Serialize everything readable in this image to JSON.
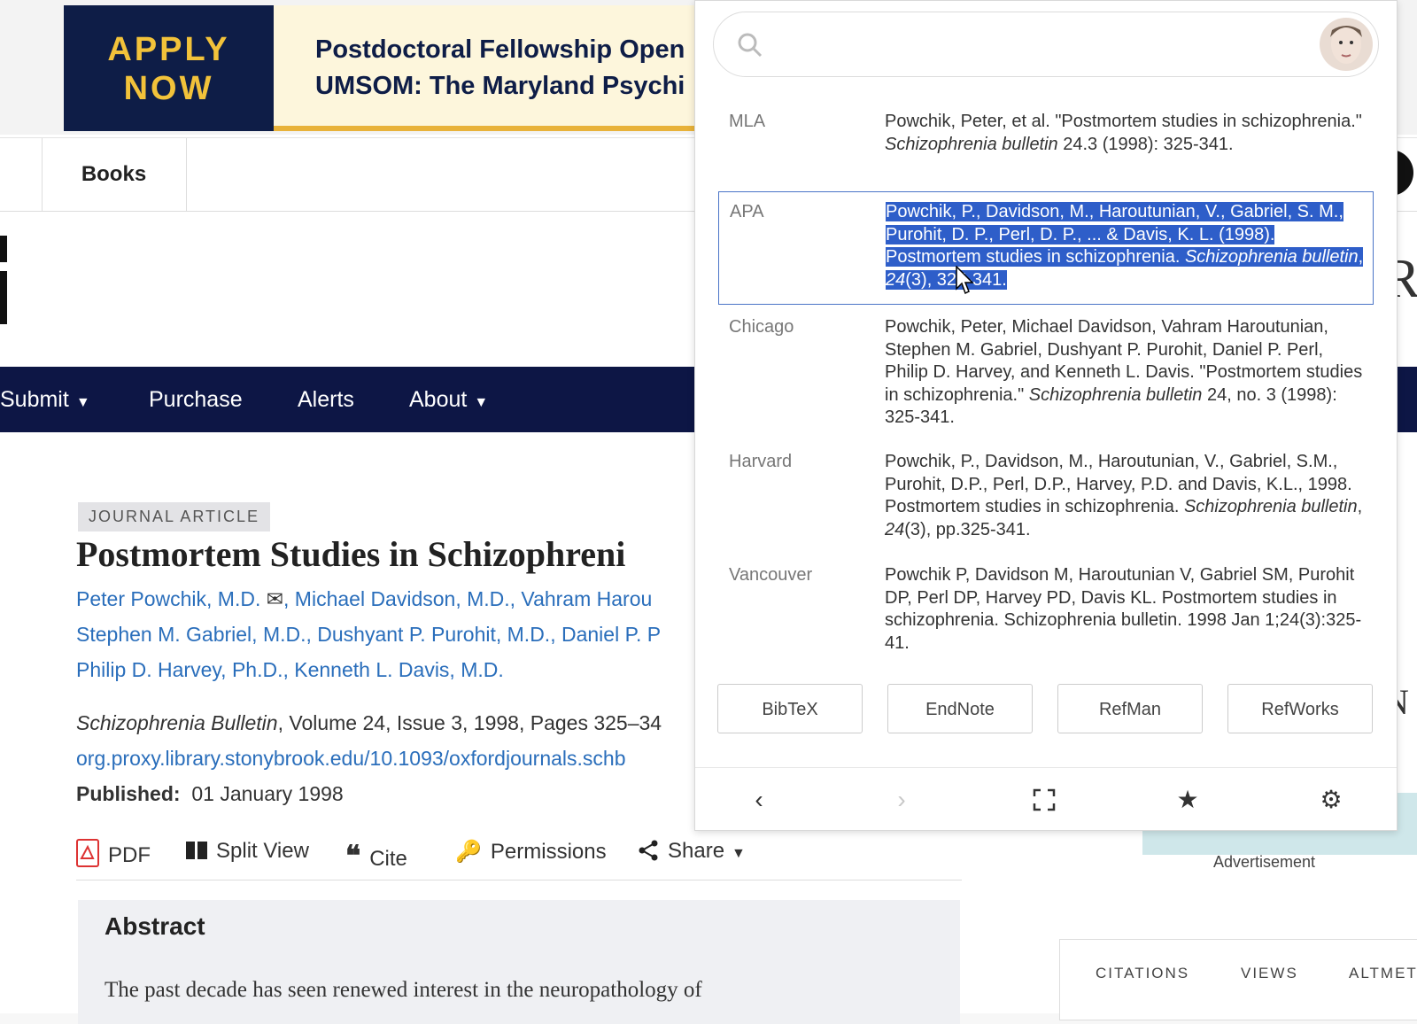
{
  "ad": {
    "cta_line1": "APPLY",
    "cta_line2": "NOW",
    "line1": "Postdoctoral Fellowship Open",
    "line2": "UMSOM: The Maryland Psychi"
  },
  "tabs": {
    "books": "Books"
  },
  "nav": {
    "submit": "Submit",
    "purchase": "Purchase",
    "alerts": "Alerts",
    "about": "About"
  },
  "article": {
    "badge": "JOURNAL ARTICLE",
    "title": "Postmortem Studies in Schizophreni",
    "authors_line1_a": "Peter Powchik, M.D.",
    "authors_line1_b": ", Michael Davidson, M.D., Vahram Harou",
    "authors_line2": "Stephen M. Gabriel, M.D., Dushyant P. Purohit, M.D., Daniel P. P",
    "authors_line3": "Philip D. Harvey, Ph.D., Kenneth L. Davis, M.D.",
    "journal": "Schizophrenia Bulletin",
    "volume_info": ", Volume 24, Issue 3, 1998, Pages 325–34",
    "doi_link": "org.proxy.library.stonybrook.edu/10.1093/oxfordjournals.schb",
    "published_label": "Published:",
    "published_date": "01 January 1998"
  },
  "actions": {
    "pdf": "PDF",
    "split_view": "Split View",
    "cite": "Cite",
    "permissions": "Permissions",
    "share": "Share"
  },
  "abstract": {
    "heading": "Abstract",
    "text": "The past decade has seen renewed interest in the neuropathology of"
  },
  "sidebar": {
    "advertisement": "Advertisement",
    "citations": "CITATIONS",
    "views": "VIEWS",
    "altmetric": "ALTMETI"
  },
  "popup": {
    "search_placeholder": "",
    "citations": [
      {
        "style": "MLA",
        "text_html": "Powchik, Peter, et al. \"Postmortem studies in schizophrenia.\" <i>Schizophrenia bulletin</i> 24.3 (1998): 325-341."
      },
      {
        "style": "APA",
        "text_html": "<span class=\"hl\">Powchik, P., Davidson, M., Haroutunian, V., Gabriel, S. M., Purohit, D. P., Perl, D. P., ... &amp; Davis, K. L. (1998). Postmortem studies in schizophrenia. <i>Schizophrenia bulletin</i>, <i>24</i>(3), 325-341.</span>"
      },
      {
        "style": "Chicago",
        "text_html": "Powchik, Peter, Michael Davidson, Vahram Haroutunian, Stephen M. Gabriel, Dushyant P. Purohit, Daniel P. Perl, Philip D. Harvey, and Kenneth L. Davis. \"Postmortem studies in schizophrenia.\" <i>Schizophrenia bulletin</i> 24, no. 3 (1998): 325-341."
      },
      {
        "style": "Harvard",
        "text_html": "Powchik, P., Davidson, M., Haroutunian, V., Gabriel, S.M., Purohit, D.P., Perl, D.P., Harvey, P.D. and Davis, K.L., 1998. Postmortem studies in schizophrenia. <i>Schizophrenia bulletin</i>, <i>24</i>(3), pp.325-341."
      },
      {
        "style": "Vancouver",
        "text_html": "Powchik P, Davidson M, Haroutunian V, Gabriel SM, Purohit DP, Perl DP, Harvey PD, Davis KL. Postmortem studies in schizophrenia. Schizophrenia bulletin. 1998 Jan 1;24(3):325-41."
      }
    ],
    "export_buttons": [
      "BibTeX",
      "EndNote",
      "RefMan",
      "RefWorks"
    ],
    "selected_style": "APA"
  },
  "colors": {
    "nav_bg": "#0d1645",
    "link": "#2a6ebb",
    "ad_gold": "#f2c23a",
    "selection": "#2e5ec9"
  }
}
